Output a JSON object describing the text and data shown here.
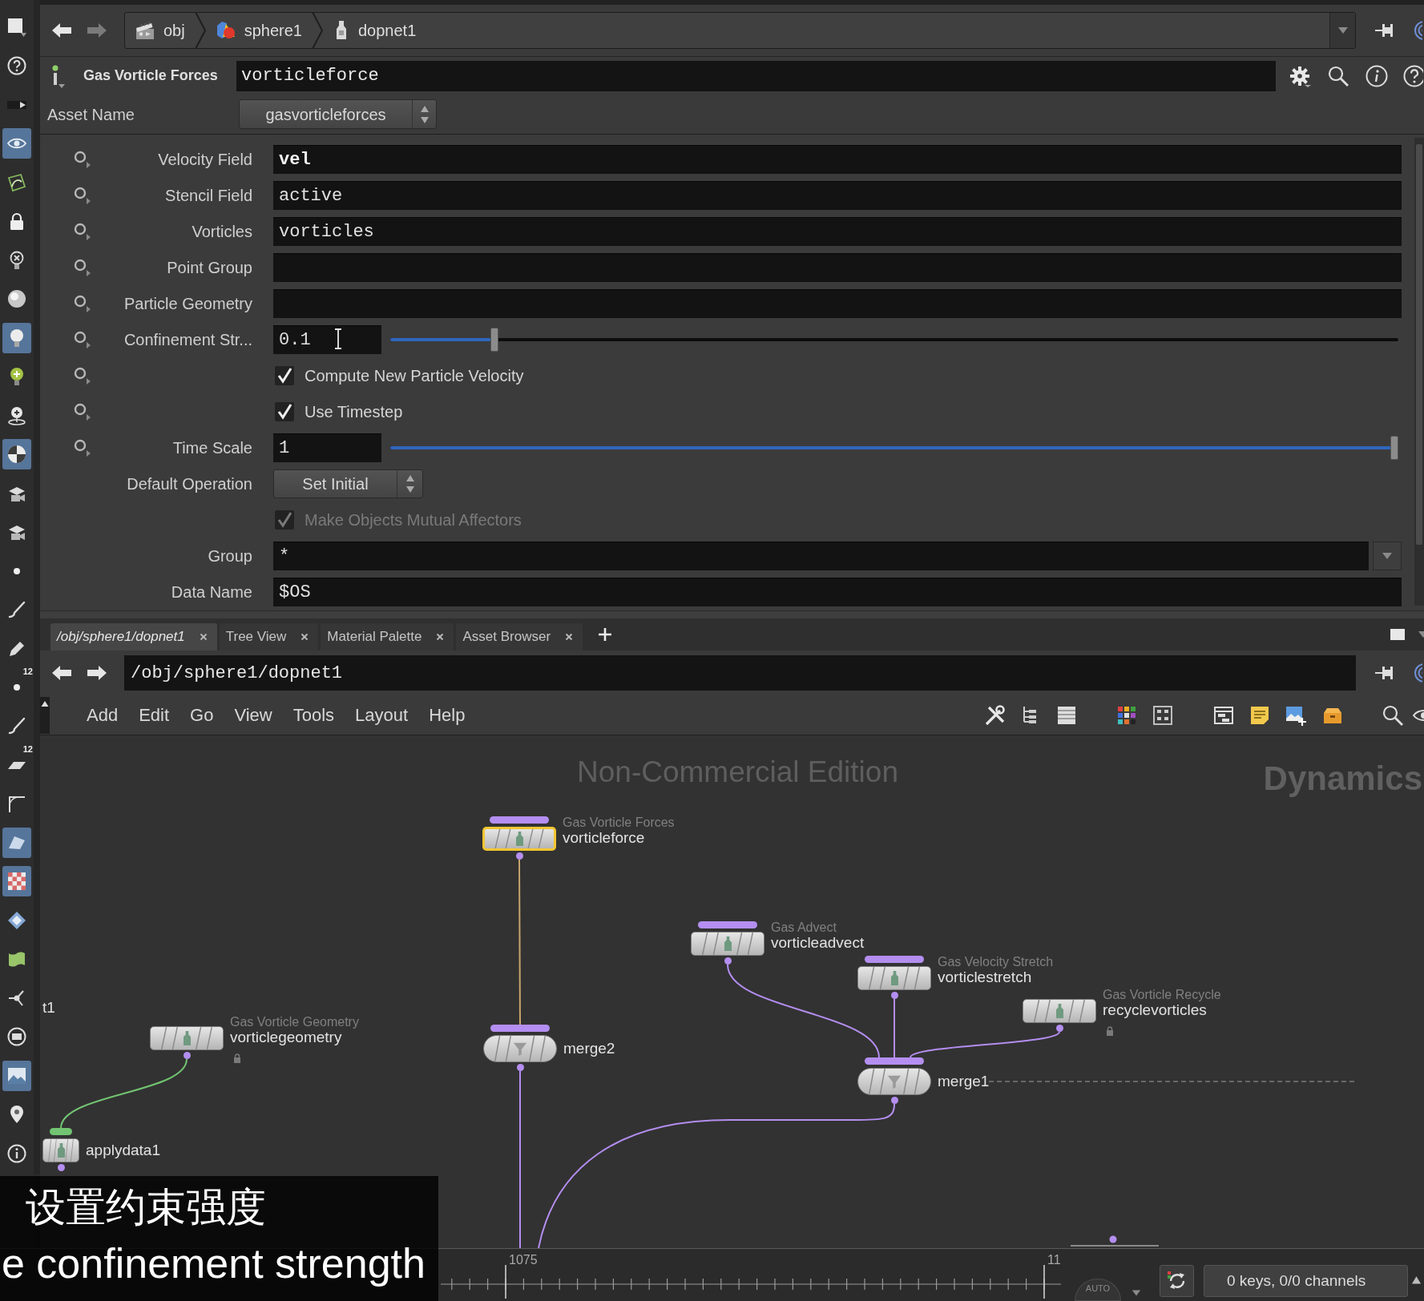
{
  "shelf_tools": [
    {
      "highlighted": false
    },
    {
      "highlighted": false
    },
    {
      "highlighted": false
    },
    {
      "highlighted": true
    },
    {
      "highlighted": false
    },
    {
      "highlighted": false
    },
    {
      "highlighted": false
    },
    {
      "highlighted": false
    },
    {
      "highlighted": true
    },
    {
      "highlighted": false
    },
    {
      "highlighted": false
    },
    {
      "highlighted": true
    },
    {
      "highlighted": false
    },
    {
      "highlighted": false
    },
    {
      "highlighted": false
    },
    {
      "highlighted": false
    },
    {
      "highlighted": false
    },
    {
      "highlighted": false,
      "badge": "12"
    },
    {
      "highlighted": false
    },
    {
      "highlighted": false,
      "badge": "12"
    },
    {
      "highlighted": false
    },
    {
      "highlighted": true
    },
    {
      "highlighted": true
    },
    {
      "highlighted": false
    },
    {
      "highlighted": false
    },
    {
      "highlighted": false
    },
    {
      "highlighted": false
    },
    {
      "highlighted": true
    },
    {
      "highlighted": false
    },
    {
      "highlighted": false
    }
  ],
  "path_bar": {
    "forward_disabled": true,
    "crumbs": [
      "obj",
      "sphere1",
      "dopnet1"
    ]
  },
  "parameters": {
    "node_type": "Gas Vorticle Forces",
    "node_name": "vorticleforce",
    "asset_label": "Asset Name",
    "asset_value": "gasvorticleforces",
    "rows": [
      {
        "kind": "field",
        "label": "Velocity Field",
        "value": "vel",
        "modified": true,
        "key_button": true,
        "disabled": false,
        "hovered": false
      },
      {
        "kind": "field",
        "label": "Stencil Field",
        "value": "active",
        "modified": false,
        "key_button": true,
        "disabled": false,
        "hovered": false
      },
      {
        "kind": "field",
        "label": "Vorticles",
        "value": "vorticles",
        "modified": false,
        "key_button": true,
        "disabled": false,
        "hovered": false
      },
      {
        "kind": "field",
        "label": "Point Group",
        "modified": false,
        "key_button": true,
        "disabled": false,
        "hovered": false
      },
      {
        "kind": "field",
        "label": "Particle Geometry",
        "modified": false,
        "key_button": true,
        "disabled": false,
        "hovered": false
      },
      {
        "kind": "slider",
        "label": "Confinement Str...",
        "value": "0.1",
        "level": 0.1,
        "modified": false,
        "key_button": true,
        "disabled": false,
        "hovered": true
      },
      {
        "kind": "checkbox",
        "label": "Compute New Particle Velocity",
        "checked": true,
        "key_button": true,
        "disabled": false,
        "hovered": false
      },
      {
        "kind": "checkbox",
        "label": "Use Timestep",
        "checked": true,
        "key_button": true,
        "disabled": false,
        "hovered": false
      },
      {
        "kind": "slider",
        "label": "Time Scale",
        "value": "1",
        "level": 1,
        "modified": false,
        "key_button": true,
        "disabled": false,
        "hovered": false
      },
      {
        "kind": "menu",
        "label": "Default Operation",
        "value": "Set Initial",
        "modified": false,
        "key_button": false,
        "disabled": false,
        "hovered": false
      },
      {
        "kind": "checkbox",
        "label": "Make Objects Mutual Affectors",
        "checked": true,
        "key_button": false,
        "disabled": true,
        "hovered": false
      },
      {
        "kind": "field_menu",
        "label": "Group",
        "value": "*",
        "modified": false,
        "key_button": false,
        "disabled": false,
        "hovered": false
      },
      {
        "kind": "field",
        "label": "Data Name",
        "value": "$OS",
        "modified": false,
        "key_button": false,
        "disabled": false,
        "hovered": false
      }
    ]
  },
  "network_tabs": [
    {
      "kind": "path",
      "label": "/obj/sphere1/dopnet1",
      "selected": true
    },
    {
      "kind": "pane",
      "label": "Tree View",
      "selected": false
    },
    {
      "kind": "pane",
      "label": "Material Palette",
      "selected": false
    },
    {
      "kind": "pane",
      "label": "Asset Browser",
      "selected": false
    }
  ],
  "network_path": "/obj/sphere1/dopnet1",
  "network_menu": [
    "Add",
    "Edit",
    "Go",
    "View",
    "Tools",
    "Layout",
    "Help"
  ],
  "network": {
    "edition_label": "Non-Commercial Edition",
    "context_label": "Dynamics",
    "nodes": [
      {
        "kind": "dop",
        "type_label": "Gas Vorticle Forces",
        "name": "vorticleforce",
        "selected": true,
        "locked": false,
        "color": "#b48ef0"
      },
      {
        "kind": "dop",
        "type_label": "Gas Advect",
        "name": "vorticleadvect",
        "selected": false,
        "locked": false,
        "color": "#b48ef0"
      },
      {
        "kind": "dop",
        "type_label": "Gas Velocity Stretch",
        "name": "vorticlestretch",
        "selected": false,
        "locked": false,
        "color": "#b48ef0"
      },
      {
        "kind": "label_only",
        "name": "t1",
        "selected": false
      },
      {
        "kind": "dop",
        "type_label": "Gas Vorticle Recycle",
        "name": "recyclevorticles",
        "selected": false,
        "locked": true
      },
      {
        "kind": "dop",
        "type_label": "Gas Vorticle Geometry",
        "name": "vorticlegeometry",
        "selected": false,
        "locked": true
      },
      {
        "kind": "merge",
        "name": "merge2",
        "selected": false,
        "locked": false,
        "color": "#b48ef0"
      },
      {
        "kind": "merge",
        "name": "merge1",
        "selected": false,
        "locked": false,
        "color": "#b48ef0"
      },
      {
        "kind": "dop",
        "name": "applydata1",
        "selected": false,
        "locked": false,
        "color": "#72c472"
      }
    ]
  },
  "timeline": {
    "frame_labels": [
      "1075",
      "11"
    ],
    "auto_label": "AUTO",
    "key_status": "0 keys, 0/0 channels"
  },
  "subtitles": [
    "设置约束强度",
    "e confinement strength"
  ]
}
